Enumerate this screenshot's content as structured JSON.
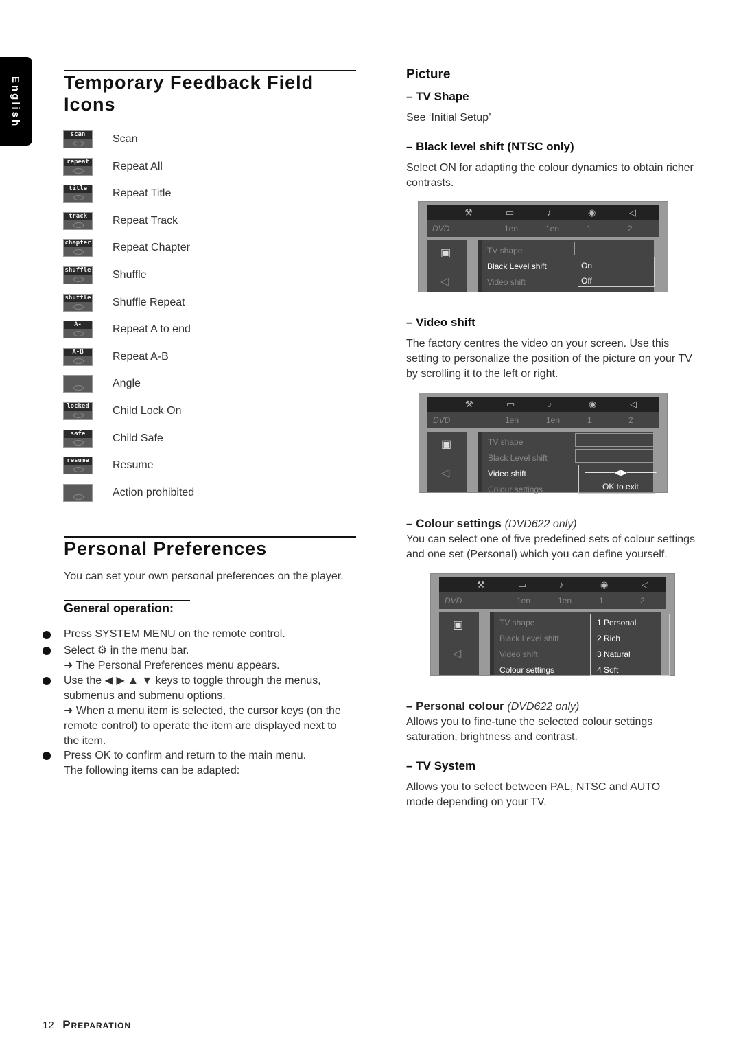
{
  "side_tab": "English",
  "left": {
    "title1": "Temporary Feedback Field Icons",
    "icons": [
      {
        "badge": "scan",
        "label": "Scan"
      },
      {
        "badge": "repeat",
        "label": "Repeat All"
      },
      {
        "badge": "title",
        "label": "Repeat Title"
      },
      {
        "badge": "track",
        "label": "Repeat Track"
      },
      {
        "badge": "chapter",
        "label": "Repeat Chapter"
      },
      {
        "badge": "shuffle",
        "label": "Shuffle"
      },
      {
        "badge": "shuffle",
        "label": "Shuffle Repeat"
      },
      {
        "badge": "A-",
        "label": "Repeat A to end"
      },
      {
        "badge": "A-B",
        "label": "Repeat A-B"
      },
      {
        "badge": "",
        "label": "Angle"
      },
      {
        "badge": "locked",
        "label": "Child Lock On"
      },
      {
        "badge": "safe",
        "label": "Child Safe"
      },
      {
        "badge": "resume",
        "label": "Resume"
      },
      {
        "badge": "",
        "label": "Action prohibited"
      }
    ],
    "title2": "Personal Preferences",
    "intro": "You can set your own personal preferences on the player.",
    "general": "General operation:",
    "steps": [
      "Press SYSTEM MENU on the remote control.",
      "Select ⚙ in the menu bar.",
      "➜ The Personal Preferences menu appears.",
      "Use the ◀ ▶ ▲ ▼ keys to toggle through the menus, submenus and submenu options.",
      "➜ When a menu item is selected, the cursor keys (on the remote control) to operate the item are displayed next to the item.",
      "Press OK to confirm and return to the main menu.",
      "The following items can be adapted:"
    ]
  },
  "right": {
    "picture": "Picture",
    "tvshape_h": "–  TV Shape",
    "tvshape_t": "See ‘Initial Setup’",
    "black_h": "–  Black level shift (NTSC only)",
    "black_t": "Select ON for adapting the colour dynamics to obtain richer contrasts.",
    "video_h": "–  Video shift",
    "video_t": "The factory centres the video on your screen. Use this setting to personalize the position of the picture on your TV by scrolling it to the left or right.",
    "colour_h": "–  Colour settings",
    "colour_note": "(DVD622 only)",
    "colour_t": "You can select one of five predefined sets of colour settings and one set (Personal) which you can define yourself.",
    "pcolour_h": "–  Personal colour",
    "pcolour_note": "(DVD622 only)",
    "pcolour_t": "Allows you to fine-tune the selected colour settings saturation, brightness and contrast.",
    "tvsys_h": "–  TV System",
    "tvsys_t": "Allows you to select between PAL, NTSC and AUTO mode depending on your TV."
  },
  "menu": {
    "bar_values": [
      "1en",
      "1en",
      "1",
      "2"
    ],
    "logo": "DVD",
    "items": [
      "TV shape",
      "Black Level shift",
      "Video shift",
      "Colour settings"
    ],
    "m1_opts": [
      "On",
      "Off"
    ],
    "m2_opt": "OK to exit",
    "m3_opts": [
      "1 Personal",
      "2 Rich",
      "3 Natural",
      "4 Soft"
    ]
  },
  "footer": {
    "page": "12",
    "section": "Preparation"
  }
}
